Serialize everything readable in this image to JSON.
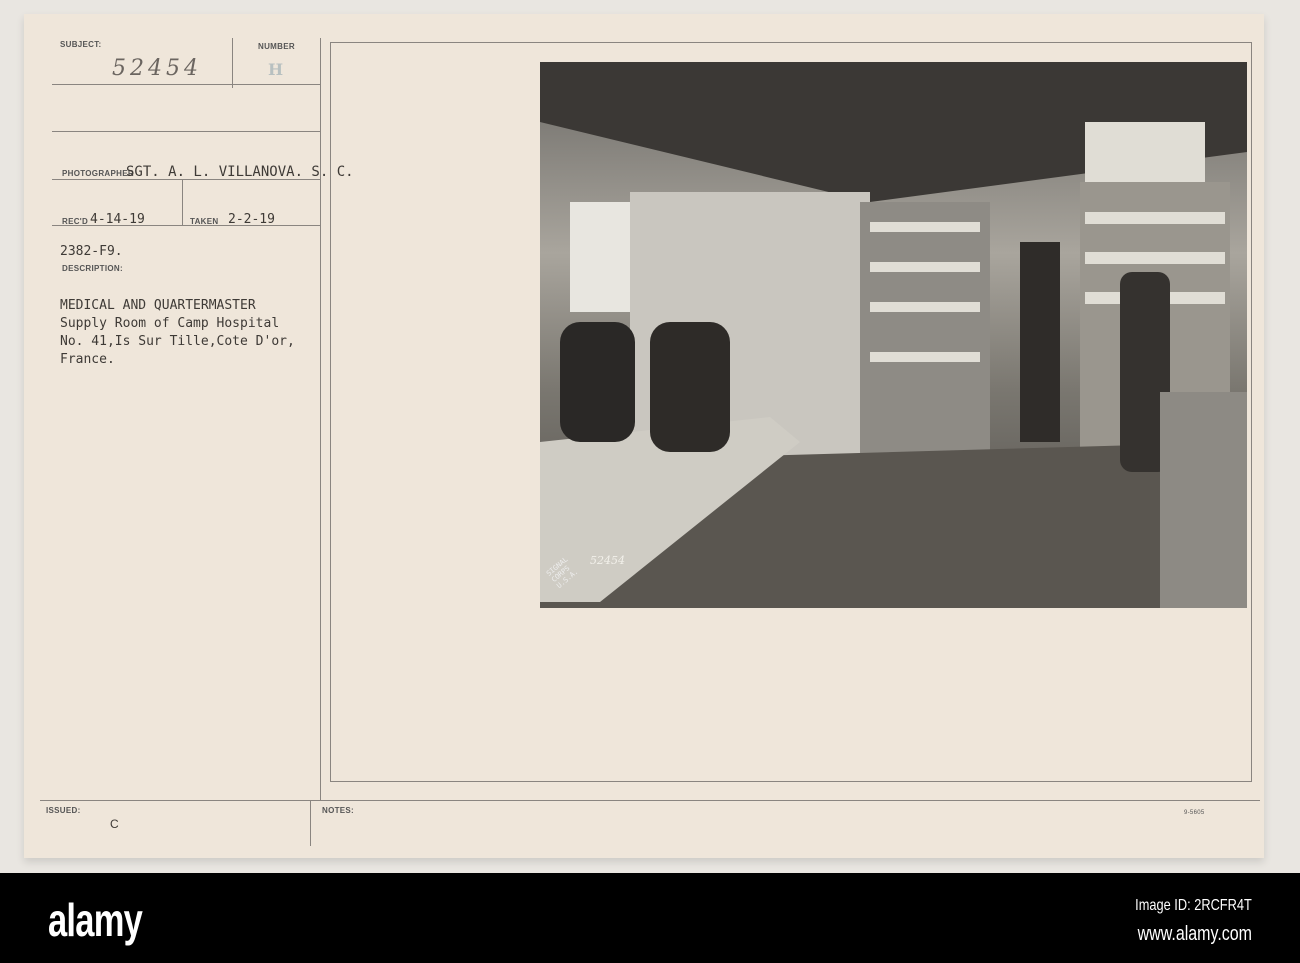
{
  "card": {
    "subject_label": "SUBJECT:",
    "subject_value": "52454",
    "number_label": "NUMBER",
    "number_value": "H",
    "photographer_label": "PHOTOGRAPHER",
    "photographer_value": "SGT. A. L. VILLANOVA. S. C.",
    "recd_label": "REC'D",
    "recd_value": "4-14-19",
    "taken_label": "TAKEN",
    "taken_value": "2-2-19",
    "ref_code": "2382-F9.",
    "description_label": "DESCRIPTION:",
    "description_lines": [
      "MEDICAL AND QUARTERMASTER",
      "Supply Room of Camp Hospital",
      "No. 41,Is Sur Tille,Cote D'or,",
      "France."
    ],
    "issued_label": "ISSUED:",
    "issued_value": "C",
    "notes_label": "NOTES:",
    "form_number": "9-5605"
  },
  "photo": {
    "stamp_text": "SIGNAL CORPS U.S.A.",
    "stamp_number": "52454"
  },
  "footer": {
    "logo": "alamy",
    "image_id": "Image ID: 2RCFR4T",
    "url": "www.alamy.com"
  }
}
